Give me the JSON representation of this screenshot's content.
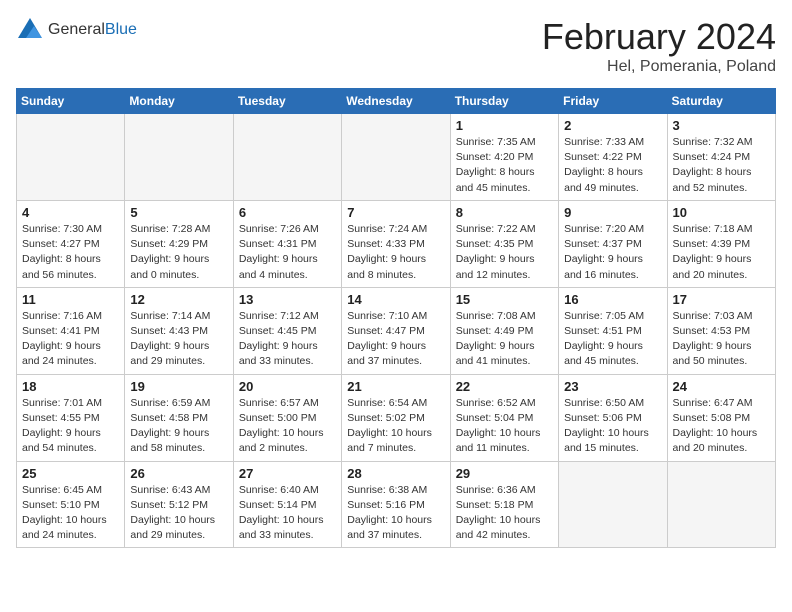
{
  "header": {
    "logo_general": "General",
    "logo_blue": "Blue",
    "title": "February 2024",
    "subtitle": "Hel, Pomerania, Poland"
  },
  "weekdays": [
    "Sunday",
    "Monday",
    "Tuesday",
    "Wednesday",
    "Thursday",
    "Friday",
    "Saturday"
  ],
  "weeks": [
    [
      {
        "day": "",
        "info": ""
      },
      {
        "day": "",
        "info": ""
      },
      {
        "day": "",
        "info": ""
      },
      {
        "day": "",
        "info": ""
      },
      {
        "day": "1",
        "info": "Sunrise: 7:35 AM\nSunset: 4:20 PM\nDaylight: 8 hours\nand 45 minutes."
      },
      {
        "day": "2",
        "info": "Sunrise: 7:33 AM\nSunset: 4:22 PM\nDaylight: 8 hours\nand 49 minutes."
      },
      {
        "day": "3",
        "info": "Sunrise: 7:32 AM\nSunset: 4:24 PM\nDaylight: 8 hours\nand 52 minutes."
      }
    ],
    [
      {
        "day": "4",
        "info": "Sunrise: 7:30 AM\nSunset: 4:27 PM\nDaylight: 8 hours\nand 56 minutes."
      },
      {
        "day": "5",
        "info": "Sunrise: 7:28 AM\nSunset: 4:29 PM\nDaylight: 9 hours\nand 0 minutes."
      },
      {
        "day": "6",
        "info": "Sunrise: 7:26 AM\nSunset: 4:31 PM\nDaylight: 9 hours\nand 4 minutes."
      },
      {
        "day": "7",
        "info": "Sunrise: 7:24 AM\nSunset: 4:33 PM\nDaylight: 9 hours\nand 8 minutes."
      },
      {
        "day": "8",
        "info": "Sunrise: 7:22 AM\nSunset: 4:35 PM\nDaylight: 9 hours\nand 12 minutes."
      },
      {
        "day": "9",
        "info": "Sunrise: 7:20 AM\nSunset: 4:37 PM\nDaylight: 9 hours\nand 16 minutes."
      },
      {
        "day": "10",
        "info": "Sunrise: 7:18 AM\nSunset: 4:39 PM\nDaylight: 9 hours\nand 20 minutes."
      }
    ],
    [
      {
        "day": "11",
        "info": "Sunrise: 7:16 AM\nSunset: 4:41 PM\nDaylight: 9 hours\nand 24 minutes."
      },
      {
        "day": "12",
        "info": "Sunrise: 7:14 AM\nSunset: 4:43 PM\nDaylight: 9 hours\nand 29 minutes."
      },
      {
        "day": "13",
        "info": "Sunrise: 7:12 AM\nSunset: 4:45 PM\nDaylight: 9 hours\nand 33 minutes."
      },
      {
        "day": "14",
        "info": "Sunrise: 7:10 AM\nSunset: 4:47 PM\nDaylight: 9 hours\nand 37 minutes."
      },
      {
        "day": "15",
        "info": "Sunrise: 7:08 AM\nSunset: 4:49 PM\nDaylight: 9 hours\nand 41 minutes."
      },
      {
        "day": "16",
        "info": "Sunrise: 7:05 AM\nSunset: 4:51 PM\nDaylight: 9 hours\nand 45 minutes."
      },
      {
        "day": "17",
        "info": "Sunrise: 7:03 AM\nSunset: 4:53 PM\nDaylight: 9 hours\nand 50 minutes."
      }
    ],
    [
      {
        "day": "18",
        "info": "Sunrise: 7:01 AM\nSunset: 4:55 PM\nDaylight: 9 hours\nand 54 minutes."
      },
      {
        "day": "19",
        "info": "Sunrise: 6:59 AM\nSunset: 4:58 PM\nDaylight: 9 hours\nand 58 minutes."
      },
      {
        "day": "20",
        "info": "Sunrise: 6:57 AM\nSunset: 5:00 PM\nDaylight: 10 hours\nand 2 minutes."
      },
      {
        "day": "21",
        "info": "Sunrise: 6:54 AM\nSunset: 5:02 PM\nDaylight: 10 hours\nand 7 minutes."
      },
      {
        "day": "22",
        "info": "Sunrise: 6:52 AM\nSunset: 5:04 PM\nDaylight: 10 hours\nand 11 minutes."
      },
      {
        "day": "23",
        "info": "Sunrise: 6:50 AM\nSunset: 5:06 PM\nDaylight: 10 hours\nand 15 minutes."
      },
      {
        "day": "24",
        "info": "Sunrise: 6:47 AM\nSunset: 5:08 PM\nDaylight: 10 hours\nand 20 minutes."
      }
    ],
    [
      {
        "day": "25",
        "info": "Sunrise: 6:45 AM\nSunset: 5:10 PM\nDaylight: 10 hours\nand 24 minutes."
      },
      {
        "day": "26",
        "info": "Sunrise: 6:43 AM\nSunset: 5:12 PM\nDaylight: 10 hours\nand 29 minutes."
      },
      {
        "day": "27",
        "info": "Sunrise: 6:40 AM\nSunset: 5:14 PM\nDaylight: 10 hours\nand 33 minutes."
      },
      {
        "day": "28",
        "info": "Sunrise: 6:38 AM\nSunset: 5:16 PM\nDaylight: 10 hours\nand 37 minutes."
      },
      {
        "day": "29",
        "info": "Sunrise: 6:36 AM\nSunset: 5:18 PM\nDaylight: 10 hours\nand 42 minutes."
      },
      {
        "day": "",
        "info": ""
      },
      {
        "day": "",
        "info": ""
      }
    ]
  ]
}
